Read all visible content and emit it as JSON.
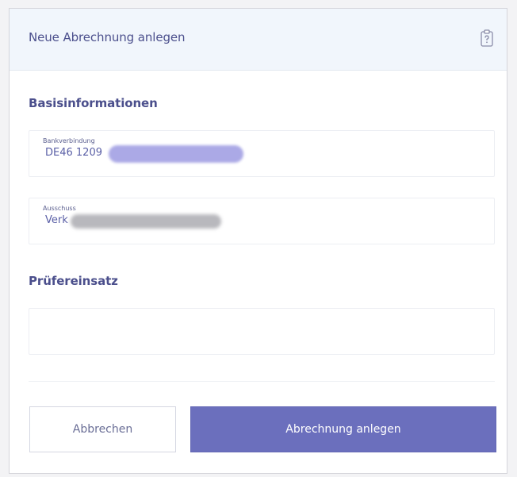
{
  "modal": {
    "title": "Neue Abrechnung anlegen",
    "help_icon": "clipboard-question-icon"
  },
  "sections": {
    "basis": "Basisinformationen",
    "pruefer": "Prüfereinsatz"
  },
  "fields": {
    "bankverbindung": {
      "label": "Bankverbindung",
      "value_visible": "DE46 1209"
    },
    "ausschuss": {
      "label": "Ausschuss",
      "value_visible": "Verk"
    },
    "pruefereinsatz": {
      "value": ""
    }
  },
  "buttons": {
    "cancel": "Abbrechen",
    "submit": "Abrechnung anlegen"
  },
  "colors": {
    "primary": "#6b6fbd",
    "title_text": "#4b4f8c",
    "header_bg": "#f1f6fc"
  }
}
